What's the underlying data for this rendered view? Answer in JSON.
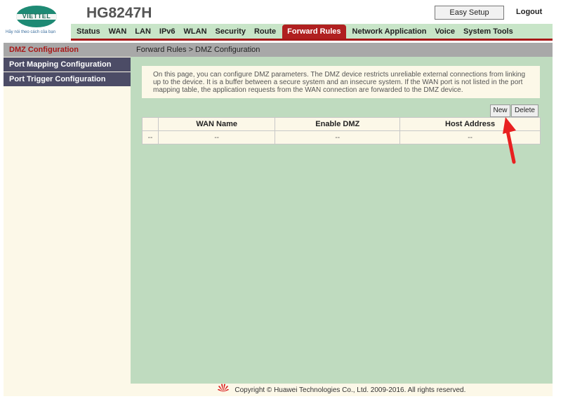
{
  "brand": {
    "logo_text": "VIETTEL",
    "slogan": "Hãy nói theo cách của bạn",
    "model": "HG8247H"
  },
  "header": {
    "easy_setup": "Easy Setup",
    "logout": "Logout"
  },
  "nav": {
    "items": [
      "Status",
      "WAN",
      "LAN",
      "IPv6",
      "WLAN",
      "Security",
      "Route",
      "Forward Rules",
      "Network Application",
      "Voice",
      "System Tools"
    ],
    "active": "Forward Rules"
  },
  "sidebar": {
    "items": [
      "DMZ Configuration",
      "Port Mapping Configuration",
      "Port Trigger Configuration"
    ],
    "active": "DMZ Configuration"
  },
  "breadcrumb": "Forward Rules > DMZ Configuration",
  "description": "On this page, you can configure DMZ parameters. The DMZ device restricts unreliable external connections from linking up to the device. It is a buffer between a secure system and an insecure system. If the WAN port is not listed in the port mapping table, the application requests from the WAN connection are forwarded to the DMZ device.",
  "buttons": {
    "new": "New",
    "delete": "Delete"
  },
  "table": {
    "columns": [
      "",
      "WAN Name",
      "Enable DMZ",
      "Host Address"
    ],
    "rows": [
      [
        "--",
        "--",
        "--",
        "--"
      ]
    ]
  },
  "footer": {
    "copyright": "Copyright © Huawei Technologies Co., Ltd. 2009-2016. All rights reserved."
  },
  "colors": {
    "accent_red": "#a81818",
    "content_green": "#bfdbbf",
    "sidebar_dark": "#4c4c66",
    "arrow_red": "#e82020"
  }
}
